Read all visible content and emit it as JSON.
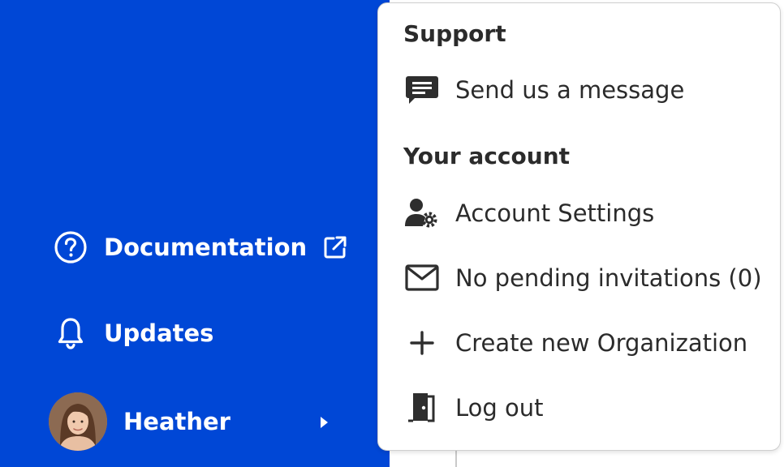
{
  "sidebar": {
    "documentation_label": "Documentation",
    "updates_label": "Updates",
    "user_name": "Heather",
    "background_color": "#0047d6"
  },
  "menu": {
    "support_title": "Support",
    "send_message_label": "Send us a message",
    "account_title": "Your account",
    "account_settings_label": "Account Settings",
    "invitations_label": "No pending invitations (0)",
    "create_org_label": "Create new Organization",
    "logout_label": "Log out"
  },
  "icons": {
    "documentation": "help-circle-icon",
    "external": "external-link-icon",
    "updates": "bell-icon",
    "user_chevron": "chevron-right-icon",
    "message": "message-icon",
    "account_settings": "user-gear-icon",
    "invitations": "mail-icon",
    "create_org": "plus-icon",
    "logout": "door-exit-icon"
  }
}
